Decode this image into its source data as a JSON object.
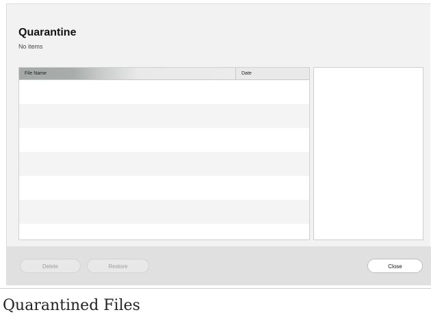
{
  "dialog": {
    "title": "Quarantine",
    "subtitle": "No items"
  },
  "table": {
    "columns": [
      "File Name",
      "Date"
    ],
    "rows": []
  },
  "footer": {
    "delete_label": "Delete",
    "restore_label": "Restore",
    "close_label": "Close"
  },
  "caption": "Quarantined Files"
}
